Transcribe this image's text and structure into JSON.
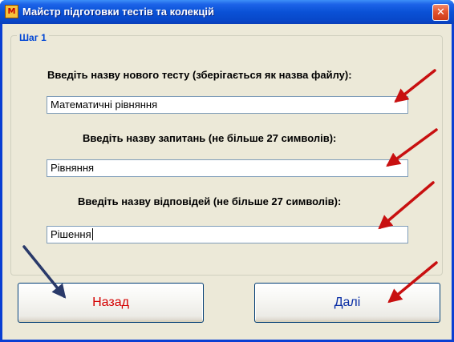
{
  "window": {
    "title": "Майстр підготовки тестів та колекцій",
    "app_icon_glyph": "M",
    "close_glyph": "✕"
  },
  "step": {
    "legend": "Шаг 1",
    "test_name_label": "Введіть назву нового тесту (зберігається як назва файлу):",
    "test_name_value": "Математичні рівняння",
    "questions_label": "Введіть назву запитань (не більше 27 символів):",
    "questions_value": "Рівняння",
    "answers_label": "Введіть назву відповідей (не більше 27 символів):",
    "answers_value": "Рішення"
  },
  "buttons": {
    "back_label": "Назад",
    "next_label": "Далі"
  },
  "colors": {
    "titlebar": "#0a51d6",
    "client_bg": "#ece9d8",
    "legend_text": "#0046d5",
    "back_text": "#d40000",
    "next_text": "#0a2ea5",
    "annotation_arrow_red": "#c81010",
    "annotation_arrow_navy": "#2a3a6a"
  },
  "icons": {
    "app": "test-maker-app-icon",
    "close": "close-icon"
  }
}
